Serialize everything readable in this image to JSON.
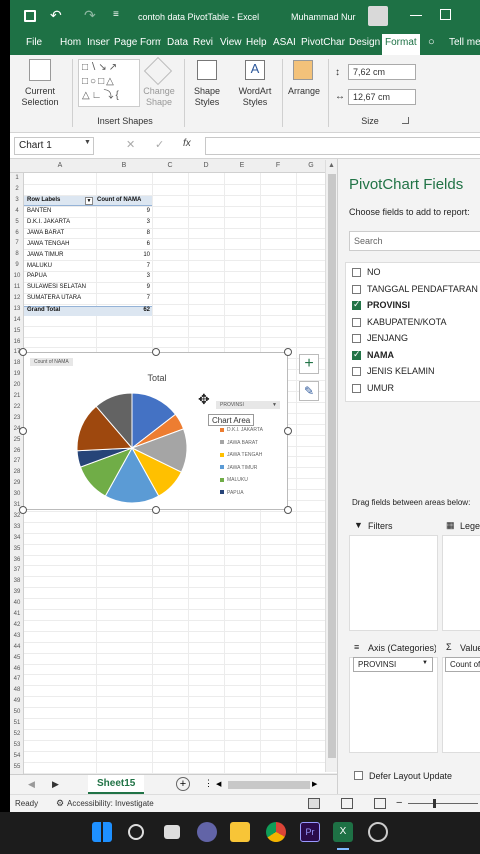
{
  "window": {
    "filename": "contoh data PivotTable",
    "app": "Excel",
    "user": "Muhammad Nur"
  },
  "tabs": [
    "File",
    "Home",
    "Insert",
    "Page",
    "Form",
    "Data",
    "Revi",
    "View",
    "Help",
    "ASAI",
    "PivotChar",
    "Design",
    "Format",
    "Tell me"
  ],
  "ribbon": {
    "current_selection": "Current Selection",
    "change_shape": "Change Shape",
    "insert_shapes": "Insert Shapes",
    "shape_styles": "Shape Styles",
    "wordart_styles": "WordArt Styles",
    "arrange": "Arrange",
    "size": "Size",
    "height": "7,62 cm",
    "width": "12,67 cm"
  },
  "namebox": "Chart 1",
  "columns": [
    "A",
    "B",
    "C",
    "D",
    "E",
    "F",
    "G"
  ],
  "pivot": {
    "headers": [
      "Row Labels",
      "Count of NAMA"
    ],
    "rows": [
      [
        "BANTEN",
        "9"
      ],
      [
        "D.K.I. JAKARTA",
        "3"
      ],
      [
        "JAWA BARAT",
        "8"
      ],
      [
        "JAWA TENGAH",
        "6"
      ],
      [
        "JAWA TIMUR",
        "10"
      ],
      [
        "MALUKU",
        "7"
      ],
      [
        "PAPUA",
        "3"
      ],
      [
        "SULAWESI SELATAN",
        "9"
      ],
      [
        "SUMATERA UTARA",
        "7"
      ]
    ],
    "total": [
      "Grand Total",
      "62"
    ]
  },
  "chart_data": {
    "type": "pie",
    "title": "Total",
    "categories": [
      "BANTEN",
      "D.K.I. JAKARTA",
      "JAWA BARAT",
      "JAWA TENGAH",
      "JAWA TIMUR",
      "MALUKU",
      "PAPUA",
      "SULAWESI SELATAN",
      "SUMATERA UTARA"
    ],
    "values": [
      9,
      3,
      8,
      6,
      10,
      7,
      3,
      9,
      7
    ],
    "colors": [
      "#4472c4",
      "#ed7d31",
      "#a5a5a5",
      "#ffc000",
      "#5b9bd5",
      "#70ad47",
      "#264478",
      "#9e480e",
      "#636363"
    ],
    "field_button": "Count of NAMA",
    "legend_filter": "PROVINSI",
    "legend_items": [
      "D.K.I. JAKARTA",
      "JAWA BARAT",
      "JAWA TENGAH",
      "JAWA TIMUR",
      "MALUKU",
      "PAPUA"
    ],
    "legend_colors": [
      "#ed7d31",
      "#a5a5a5",
      "#ffc000",
      "#5b9bd5",
      "#70ad47",
      "#264478"
    ],
    "tooltip": "Chart Area"
  },
  "pane": {
    "title": "PivotChart Fields",
    "subtitle": "Choose fields to add to report:",
    "search_placeholder": "Search",
    "fields": [
      {
        "label": "NO",
        "checked": false
      },
      {
        "label": "TANGGAL PENDAFTARAN",
        "checked": false
      },
      {
        "label": "PROVINSI",
        "checked": true
      },
      {
        "label": "KABUPATEN/KOTA",
        "checked": false
      },
      {
        "label": "JENJANG",
        "checked": false
      },
      {
        "label": "NAMA",
        "checked": true
      },
      {
        "label": "JENIS KELAMIN",
        "checked": false
      },
      {
        "label": "UMUR",
        "checked": false
      }
    ],
    "drag_text": "Drag fields between areas below:",
    "filters": "Filters",
    "legend": "Legend",
    "axis": "Axis (Categories)",
    "values": "Values",
    "axis_item": "PROVINSI",
    "values_item": "Count of NAMA",
    "defer": "Defer Layout Update"
  },
  "sheet_tab": "Sheet15",
  "status": {
    "ready": "Ready",
    "accessibility": "Accessibility: Investigate"
  }
}
